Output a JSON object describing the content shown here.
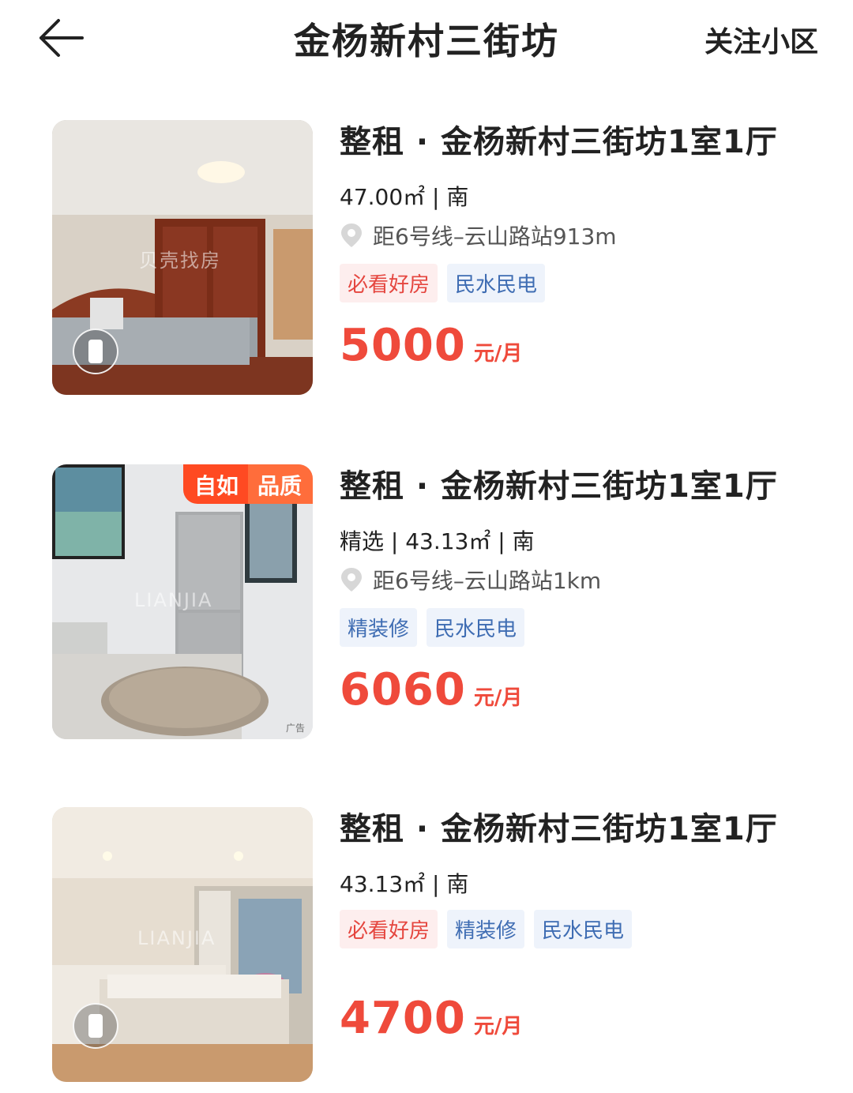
{
  "header": {
    "title": "金杨新村三街坊",
    "follow_label": "关注小区"
  },
  "listings": [
    {
      "title": "整租 · 金杨新村三街坊1室1厅",
      "meta": "47.00㎡ | 南",
      "location": "距6号线–云山路站913m",
      "tags": [
        "必看好房",
        "民水民电"
      ],
      "price": "5000",
      "unit": "元/月",
      "watermark": "贝壳找房"
    },
    {
      "title": "整租 · 金杨新村三街坊1室1厅",
      "meta": "精选 | 43.13㎡ | 南",
      "location": "距6号线–云山路站1km",
      "tags": [
        "精装修",
        "民水民电"
      ],
      "price": "6060",
      "unit": "元/月",
      "badges": [
        "自如",
        "品质"
      ],
      "ad_label": "广告",
      "watermark": "LIANJIA"
    },
    {
      "title": "整租 · 金杨新村三街坊1室1厅",
      "meta": "43.13㎡ | 南",
      "tags": [
        "必看好房",
        "精装修",
        "民水民电"
      ],
      "price": "4700",
      "unit": "元/月",
      "watermark": "LIANJIA"
    }
  ],
  "colors": {
    "price": "#ef4a3b",
    "tag_red": "#e5463f",
    "tag_blue": "#3f6db3",
    "badge": "#ff4a22"
  },
  "icons": {
    "back": "arrow-left-icon",
    "location": "location-pin-icon",
    "vr": "vr-view-icon"
  }
}
